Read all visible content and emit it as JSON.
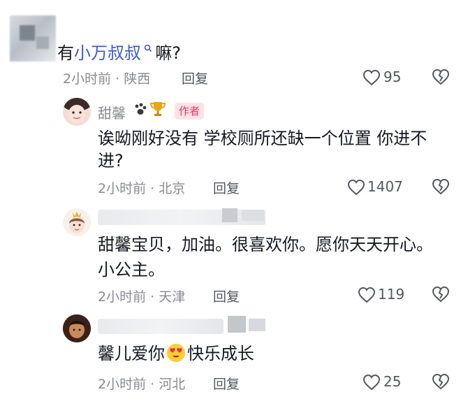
{
  "comments": [
    {
      "text_before": "有",
      "mention": "小万叔叔",
      "mention_icon": "🔍",
      "text_after": "嘛?",
      "time": "2小时前",
      "sep": "·",
      "location": "陕西",
      "reply_label": "回复",
      "likes": "95"
    },
    {
      "author": "甜馨",
      "author_badge": "作者",
      "author_icons": [
        "paw-print-icon",
        "trophy-icon"
      ],
      "text_line1": "诶呦刚好没有 学校厕所还缺一个位置 你进不",
      "text_line2": "进?",
      "time": "2小时前",
      "sep": "·",
      "location": "北京",
      "reply_label": "回复",
      "likes": "1407"
    },
    {
      "text_line1": "甜馨宝贝，加油。很喜欢你。愿你天天开心。",
      "text_line2": "小公主。",
      "time": "2小时前",
      "sep": "·",
      "location": "天津",
      "reply_label": "回复",
      "likes": "119"
    },
    {
      "text_before": "馨儿爱你",
      "emoji": "😍",
      "text_after": "快乐成长",
      "time": "2小时前",
      "sep": "·",
      "location": "河北",
      "reply_label": "回复",
      "likes": "25"
    }
  ],
  "colors": {
    "mention": "#3d5ad6",
    "author_badge_text": "#f2365b",
    "author_badge_bg": "#fde3e6",
    "meta_text": "#8a8b91",
    "body_text": "#161823"
  }
}
